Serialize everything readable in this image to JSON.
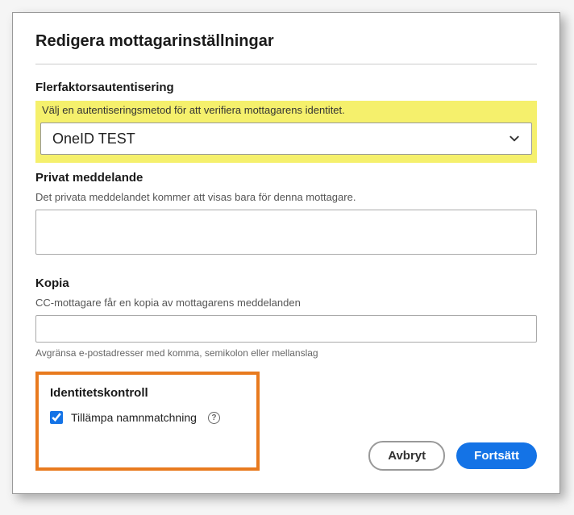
{
  "dialog": {
    "title": "Redigera mottagarinställningar"
  },
  "mfa": {
    "label": "Flerfaktorsautentisering",
    "helper": "Välj en autentiseringsmetod för att verifiera mottagarens identitet.",
    "selected": "OneID TEST"
  },
  "privateMessage": {
    "label": "Privat meddelande",
    "helper": "Det privata meddelandet kommer att visas bara för denna mottagare."
  },
  "copy": {
    "label": "Kopia",
    "helper": "CC-mottagare får en kopia av mottagarens meddelanden",
    "hint": "Avgränsa e-postadresser med komma, semikolon eller mellanslag"
  },
  "identity": {
    "label": "Identitetskontroll",
    "checkboxLabel": "Tillämpa namnmatchning",
    "checked": true
  },
  "buttons": {
    "cancel": "Avbryt",
    "continue": "Fortsätt"
  }
}
